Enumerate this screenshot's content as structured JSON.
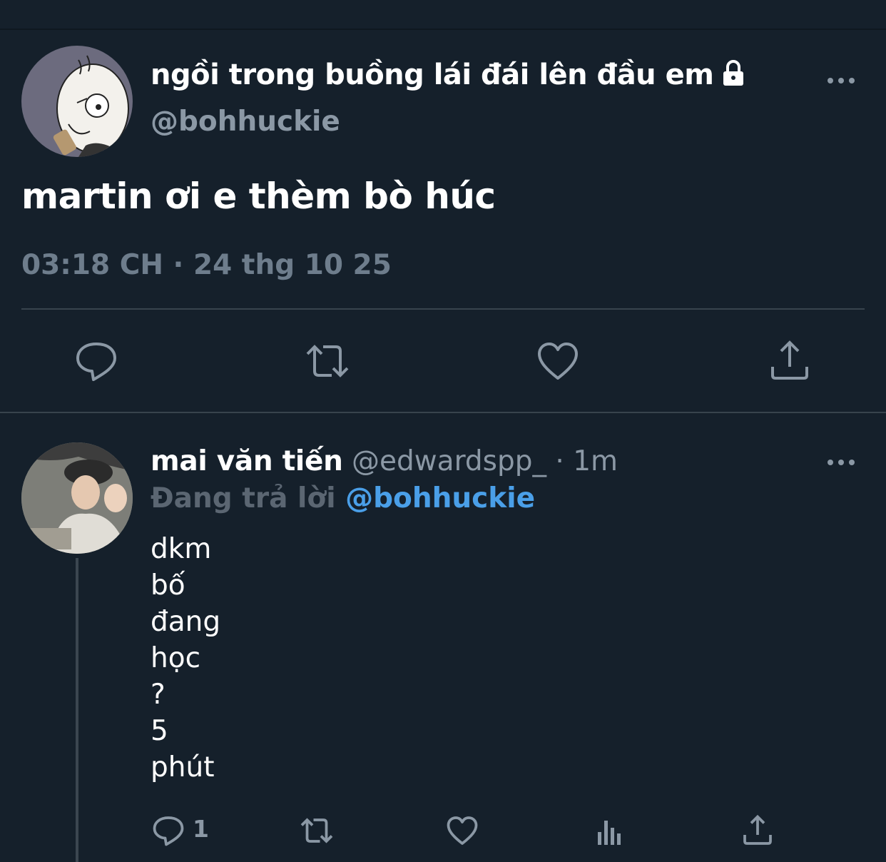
{
  "main_tweet": {
    "display_name": "ngồi trong buồng lái đái lên đầu em",
    "handle": "@bohhuckie",
    "text": "martin ơi e thèm bò húc",
    "timestamp": "03:18 CH · 24 thg 10 25",
    "icons": [
      "lock-icon",
      "more-icon",
      "reply-icon",
      "retweet-icon",
      "like-icon",
      "share-icon"
    ]
  },
  "reply": {
    "display_name": "mai văn tiến",
    "meta": "@edwardspp_ · 1m",
    "replying_label": "Đang trả lời",
    "replying_to": "@bohhuckie",
    "lines": [
      "dkm",
      "bố",
      "đang",
      "học",
      "?",
      "5",
      "phút"
    ],
    "reply_count": "1",
    "icons": [
      "reply-icon",
      "retweet-icon",
      "like-icon",
      "analytics-icon",
      "share-icon",
      "more-icon"
    ]
  },
  "colors": {
    "background": "#15202b",
    "text_primary": "#ffffff",
    "text_secondary": "#8b98a5",
    "mention": "#4a9fe8",
    "divider": "#38444d"
  }
}
